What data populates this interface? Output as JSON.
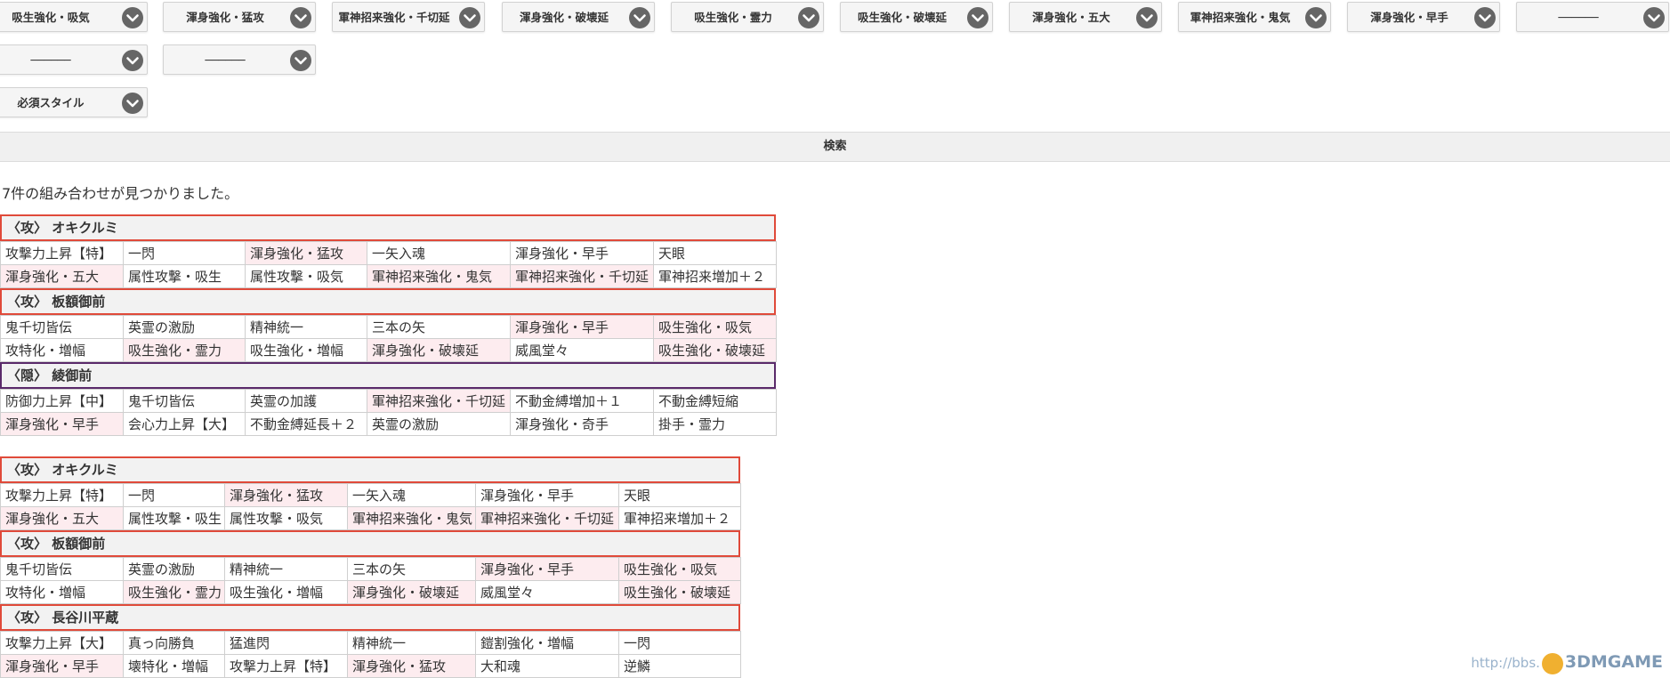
{
  "filters": {
    "selects": [
      {
        "value": "吸生強化・吸気"
      },
      {
        "value": "渾身強化・猛攻"
      },
      {
        "value": "軍神招来強化・千切延"
      },
      {
        "value": "渾身強化・破壊延"
      },
      {
        "value": "吸生強化・霊力"
      },
      {
        "value": "吸生強化・破壊延"
      },
      {
        "value": "渾身強化・五大"
      },
      {
        "value": "軍神招来強化・鬼気"
      },
      {
        "value": "渾身強化・早手"
      },
      {
        "value": "──────"
      },
      {
        "value": "──────"
      },
      {
        "value": "──────"
      },
      {
        "value": "必須スタイル"
      }
    ],
    "search_label": "検索"
  },
  "results": {
    "count_text": "7件の組み合わせが見つかりました。",
    "blocks": [
      {
        "groups": [
          {
            "header": "〈攻〉 オキクルミ",
            "rows": [
              [
                "攻撃力上昇【特】",
                "一閃",
                "渾身強化・猛攻",
                "一矢入魂",
                "渾身強化・早手",
                "天眼"
              ],
              [
                "渾身強化・五大",
                "属性攻撃・吸生",
                "属性攻撃・吸気",
                "軍神招来強化・鬼気",
                "軍神招来強化・千切延",
                "軍神招来増加＋２"
              ]
            ]
          },
          {
            "header": "〈攻〉 板額御前",
            "rows": [
              [
                "鬼千切皆伝",
                "英霊の激励",
                "精神統一",
                "三本の矢",
                "渾身強化・早手",
                "吸生強化・吸気"
              ],
              [
                "攻特化・増幅",
                "吸生強化・霊力",
                "吸生強化・増幅",
                "渾身強化・破壊延",
                "威風堂々",
                "吸生強化・破壊延"
              ]
            ]
          },
          {
            "header": "〈隠〉 綾御前",
            "rows": [
              [
                "防御力上昇【中】",
                "鬼千切皆伝",
                "英霊の加護",
                "軍神招来強化・千切延",
                "不動金縛増加＋１",
                "不動金縛短縮"
              ],
              [
                "渾身強化・早手",
                "会心力上昇【大】",
                "不動金縛延長＋２",
                "英霊の激励",
                "渾身強化・奇手",
                "掛手・霊力"
              ]
            ]
          }
        ]
      },
      {
        "groups": [
          {
            "header": "〈攻〉 オキクルミ",
            "rows": [
              [
                "攻撃力上昇【特】",
                "一閃",
                "渾身強化・猛攻",
                "一矢入魂",
                "渾身強化・早手",
                "天眼"
              ],
              [
                "渾身強化・五大",
                "属性攻撃・吸生",
                "属性攻撃・吸気",
                "軍神招来強化・鬼気",
                "軍神招来強化・千切延",
                "軍神招来増加＋２"
              ]
            ]
          },
          {
            "header": "〈攻〉 板額御前",
            "rows": [
              [
                "鬼千切皆伝",
                "英霊の激励",
                "精神統一",
                "三本の矢",
                "渾身強化・早手",
                "吸生強化・吸気"
              ],
              [
                "攻特化・増幅",
                "吸生強化・霊力",
                "吸生強化・増幅",
                "渾身強化・破壊延",
                "威風堂々",
                "吸生強化・破壊延"
              ]
            ]
          },
          {
            "header": "〈攻〉 長谷川平蔵",
            "rows": [
              [
                "攻撃力上昇【大】",
                "真っ向勝負",
                "猛進閃",
                "精神統一",
                "鎧割強化・増幅",
                "一閃"
              ],
              [
                "渾身強化・早手",
                "壊特化・増幅",
                "攻撃力上昇【特】",
                "渾身強化・猛攻",
                "大和魂",
                "逆鱗"
              ]
            ]
          }
        ]
      }
    ]
  },
  "watermark": {
    "url_text": "http://bbs.",
    "brand": "3DMGAME"
  },
  "colors": {
    "header_border": "#e04a3a",
    "header_border_alt": "#5a2a6a",
    "highlight_cell": "#fdecef"
  }
}
